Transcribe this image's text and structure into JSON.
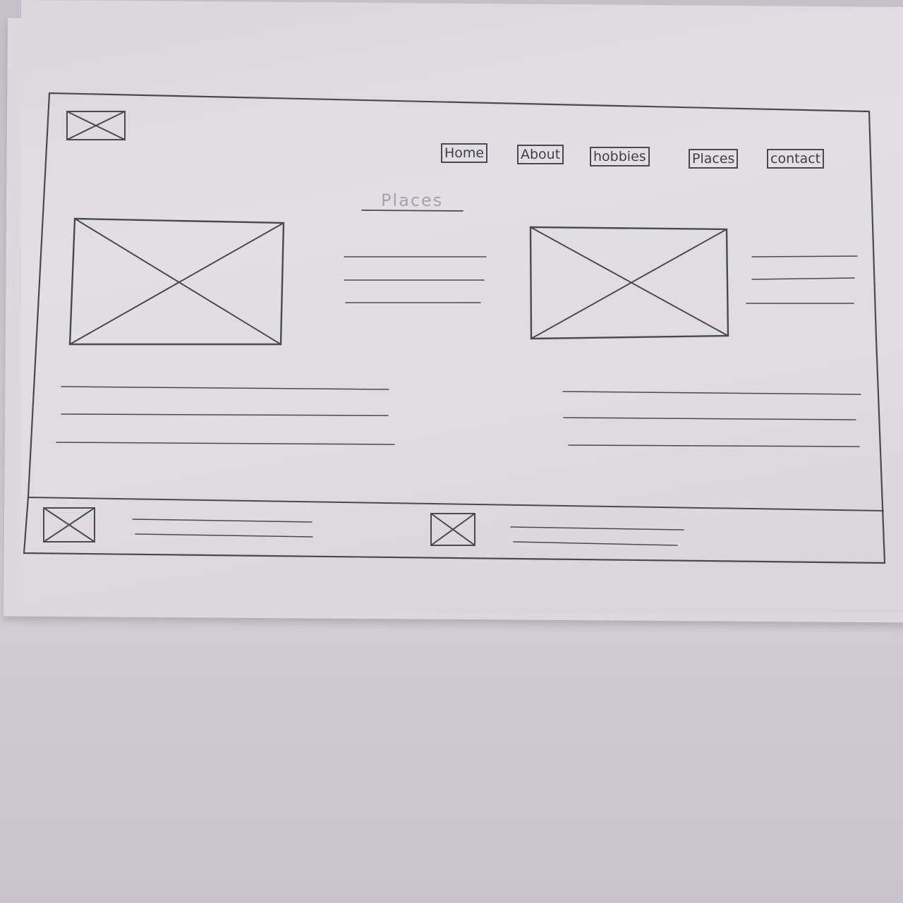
{
  "sketch": {
    "logo_placeholder": "image-placeholder-icon",
    "nav": {
      "items": [
        {
          "label": "Home"
        },
        {
          "label": "About"
        },
        {
          "label": "hobbies"
        },
        {
          "label": "Places"
        },
        {
          "label": "contact"
        }
      ]
    },
    "main": {
      "heading": "Places"
    },
    "colors": {
      "pencil": "#4a4a4e",
      "paper": "#e0dde2",
      "background": "#c9c6cd"
    }
  }
}
